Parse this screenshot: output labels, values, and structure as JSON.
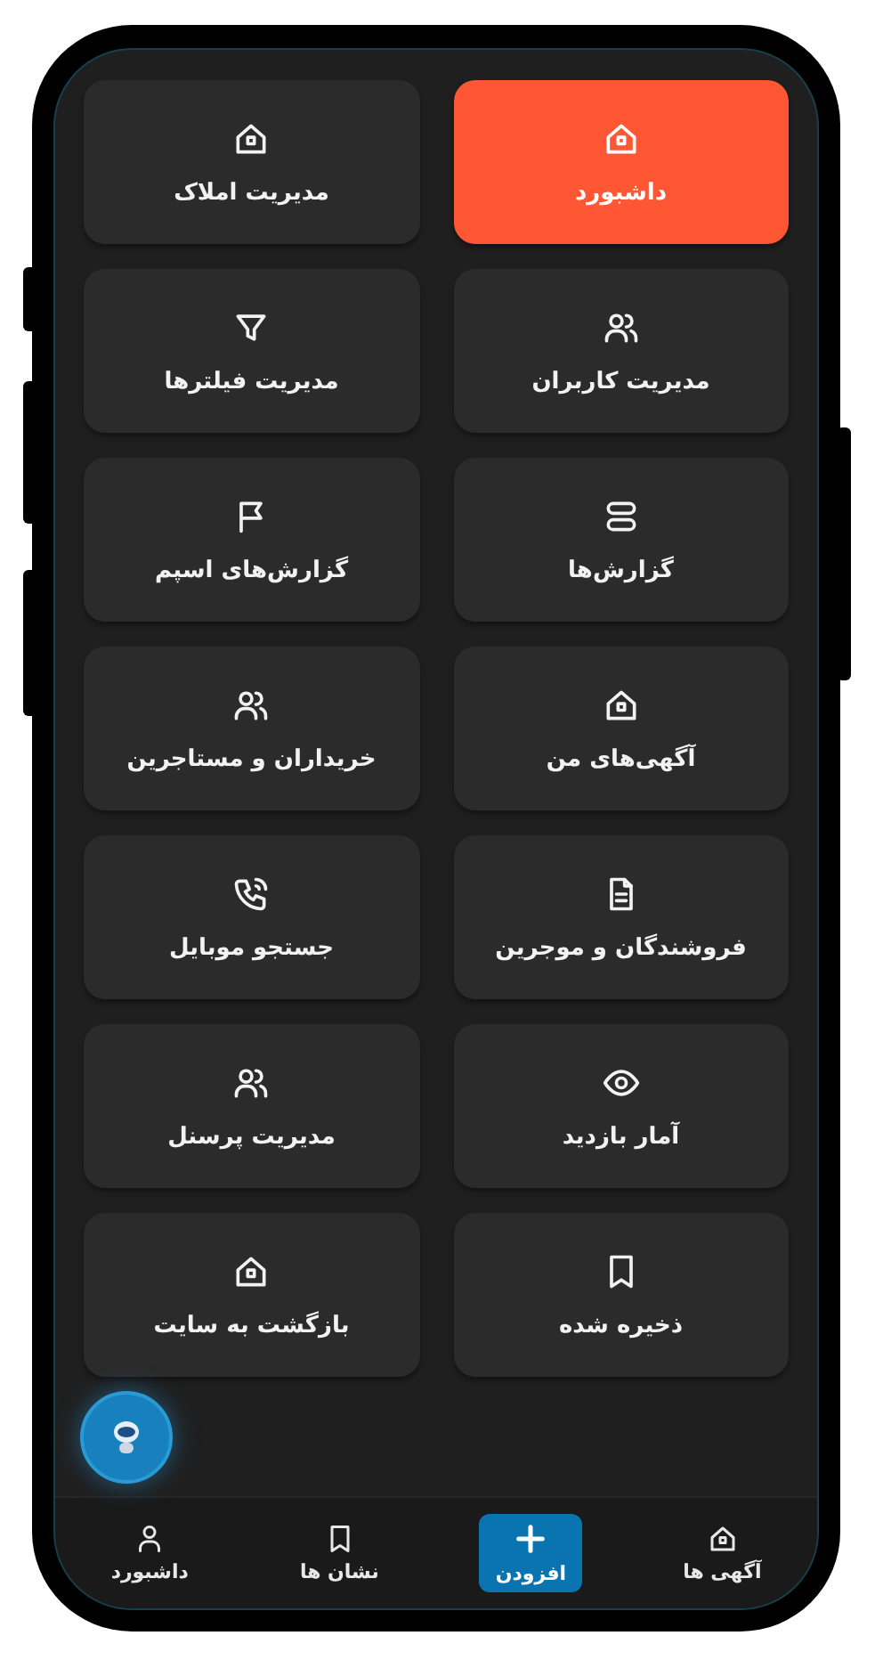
{
  "tiles": [
    {
      "label": "داشبورد",
      "kind": "home",
      "selected": true
    },
    {
      "label": "مدیریت املاک",
      "kind": "home",
      "selected": false
    },
    {
      "label": "مدیریت کاربران",
      "kind": "users",
      "selected": false
    },
    {
      "label": "مدیریت فیلترها",
      "kind": "filter",
      "selected": false
    },
    {
      "label": "گزارش‌ها",
      "kind": "stack",
      "selected": false
    },
    {
      "label": "گزارش‌های اسپم",
      "kind": "flag",
      "selected": false
    },
    {
      "label": "آگهی‌های من",
      "kind": "home",
      "selected": false
    },
    {
      "label": "خریداران و مستاجرین",
      "kind": "users",
      "selected": false
    },
    {
      "label": "فروشندگان و موجرین",
      "kind": "document",
      "selected": false
    },
    {
      "label": "جستجو موبایل",
      "kind": "phone",
      "selected": false
    },
    {
      "label": "آمار بازدید",
      "kind": "eye",
      "selected": false
    },
    {
      "label": "مدیریت پرسنل",
      "kind": "users",
      "selected": false
    },
    {
      "label": "ذخیره شده",
      "kind": "bookmark",
      "selected": false
    },
    {
      "label": "بازگشت به سایت",
      "kind": "home",
      "selected": false
    }
  ],
  "nav": [
    {
      "label": "آگهی ها",
      "kind": "home"
    },
    {
      "label": "افزودن",
      "kind": "add"
    },
    {
      "label": "نشان ها",
      "kind": "bookmark"
    },
    {
      "label": "داشبورد",
      "kind": "person"
    }
  ]
}
